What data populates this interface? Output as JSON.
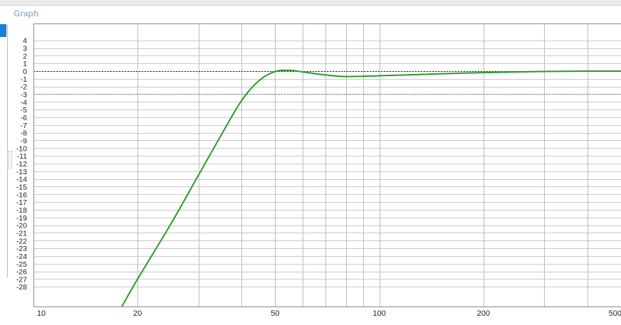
{
  "panel": {
    "title": "Graph"
  },
  "chart_data": {
    "type": "line",
    "title": "",
    "xlabel": "",
    "ylabel": "",
    "xscale": "log",
    "xlim": [
      10,
      500
    ],
    "ylim": [
      -29,
      6
    ],
    "x_tick_labels": [
      "10",
      "20",
      "50",
      "100",
      "200",
      "500"
    ],
    "x_ticks": [
      10,
      20,
      50,
      100,
      200,
      500
    ],
    "x_minor_ticks": [
      30,
      40,
      60,
      70,
      80,
      90,
      300,
      400
    ],
    "y_tick_labels": [
      "4",
      "3",
      "2",
      "1",
      "0",
      "-1",
      "-2",
      "-3",
      "-4",
      "-5",
      "-6",
      "-7",
      "-8",
      "-9",
      "-10",
      "-11",
      "-12",
      "-13",
      "-14",
      "-15",
      "-16",
      "-17",
      "-18",
      "-19",
      "-20",
      "-21",
      "-22",
      "-23",
      "-24",
      "-25",
      "-26",
      "-27",
      "-28"
    ],
    "y_ticks": [
      4,
      3,
      2,
      1,
      0,
      -1,
      -2,
      -3,
      -4,
      -5,
      -6,
      -7,
      -8,
      -9,
      -10,
      -11,
      -12,
      -13,
      -14,
      -15,
      -16,
      -17,
      -18,
      -19,
      -20,
      -21,
      -22,
      -23,
      -24,
      -25,
      -26,
      -27,
      -28
    ],
    "reference_lines": [
      {
        "y": 0,
        "style": "dashed",
        "color": "#222222"
      },
      {
        "y": -3,
        "style": "dashed",
        "color": "#777777"
      }
    ],
    "grid": true,
    "series": [
      {
        "color": "#2a9a2a",
        "x": [
          18,
          20,
          25,
          30,
          35,
          40,
          45,
          50,
          55,
          60,
          70,
          80,
          100,
          150,
          200,
          300,
          400,
          500
        ],
        "y": [
          -30.6,
          -27.0,
          -19.8,
          -13.5,
          -8.2,
          -3.8,
          -1.2,
          -0.05,
          0.1,
          -0.1,
          -0.5,
          -0.7,
          -0.6,
          -0.35,
          -0.2,
          -0.05,
          0.0,
          0.0
        ]
      }
    ]
  }
}
